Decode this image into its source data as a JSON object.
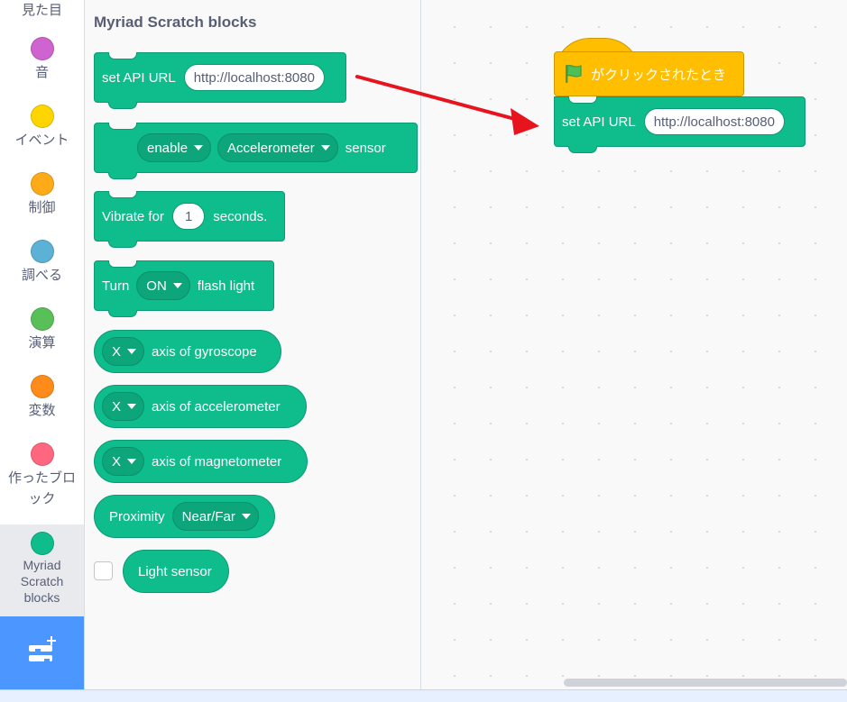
{
  "categories": [
    {
      "label": "見た目",
      "color": ""
    },
    {
      "label": "音",
      "color": "#cf63cf"
    },
    {
      "label": "イベント",
      "color": "#ffd500"
    },
    {
      "label": "制御",
      "color": "#ffab19"
    },
    {
      "label": "調べる",
      "color": "#5cb1d6"
    },
    {
      "label": "演算",
      "color": "#59c059"
    },
    {
      "label": "変数",
      "color": "#ff8c1a"
    },
    {
      "label": "作ったブロック",
      "color": "#ff6680"
    },
    {
      "label": "Myriad Scratch blocks",
      "color": "#0fbd8c"
    }
  ],
  "flyout": {
    "title": "Myriad Scratch blocks",
    "set_api": {
      "label": "set API URL",
      "value": "http://localhost:8080"
    },
    "enable_sensor": {
      "toggle": "enable",
      "sensor": "Accelerometer",
      "suffix": "sensor"
    },
    "vibrate": {
      "prefix": "Vibrate for",
      "value": "1",
      "suffix": "seconds."
    },
    "flash": {
      "prefix": "Turn",
      "state": "ON",
      "suffix": "flash light"
    },
    "gyroscope": {
      "axis": "X",
      "label": "axis of gyroscope"
    },
    "accelerometer": {
      "axis": "X",
      "label": "axis of accelerometer"
    },
    "magnetometer": {
      "axis": "X",
      "label": "axis of magnetometer"
    },
    "proximity": {
      "label": "Proximity",
      "value": "Near/Far"
    },
    "light": {
      "label": "Light sensor"
    }
  },
  "workspace": {
    "hat_label": "がクリックされたとき",
    "set_api": {
      "label": "set API URL",
      "value": "http://localhost:8080"
    }
  },
  "colors": {
    "extension_green": "#0fbd8c",
    "events_yellow": "#ffbf00",
    "annotation_red": "#e8141d",
    "accent_blue": "#4c97ff"
  }
}
